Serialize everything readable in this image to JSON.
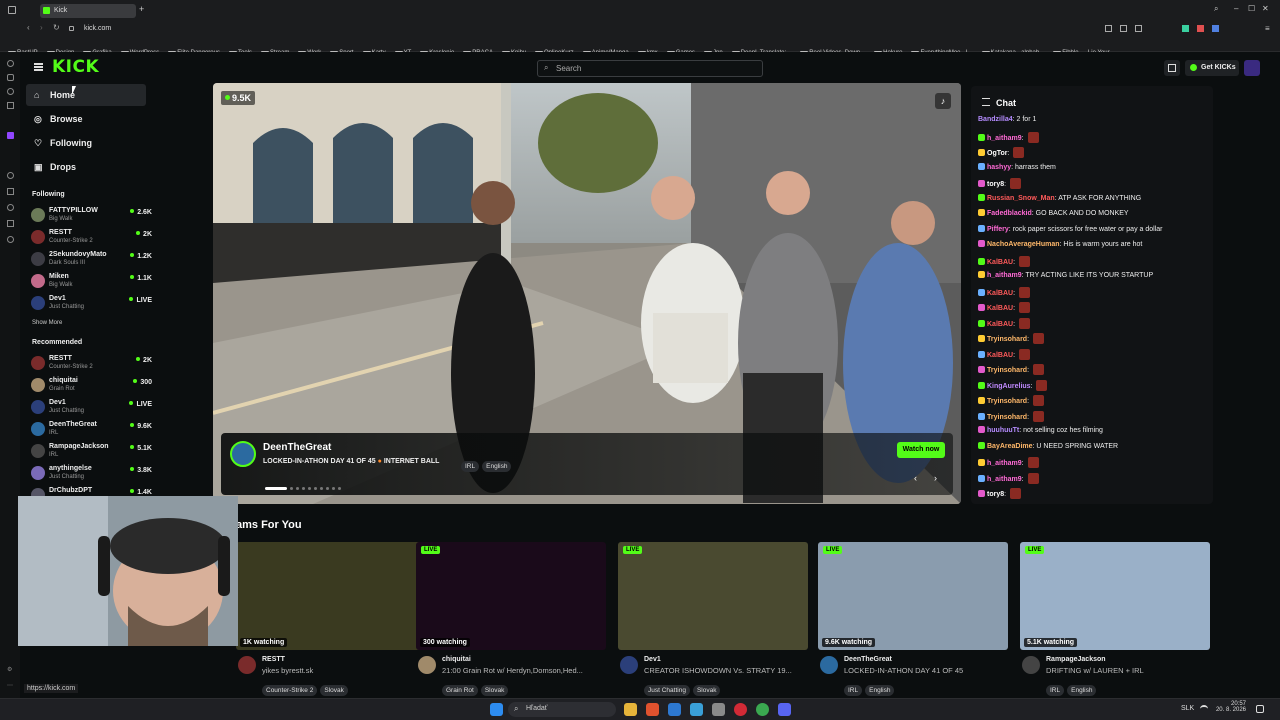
{
  "browser": {
    "tab_title": "Kick",
    "url": "kick.com",
    "status_url": "https://kick.com",
    "bookmarks": [
      "RastUP",
      "Design",
      "Grafika",
      "WordPress",
      "Elite Dangerous",
      "Tools",
      "Stream",
      "Work",
      "Sport",
      "Karty",
      "YT",
      "Kreslenie",
      "PRACA",
      "Knihy",
      "OnlineKurz",
      "Anime/Manga",
      "kmx",
      "Games",
      "Jpn",
      "DeepL Translate:...",
      "Reel Videos, Down...",
      "Hokuro",
      "EverythingMoe - I...",
      "Katakana - alphab...",
      "Fibble — Lie Your..."
    ]
  },
  "header": {
    "logo": "KICK",
    "search_placeholder": "Search",
    "get_kicks": "Get KICKs"
  },
  "nav": {
    "items": [
      {
        "label": "Home",
        "icon": "home-icon"
      },
      {
        "label": "Browse",
        "icon": "compass-icon"
      },
      {
        "label": "Following",
        "icon": "heart-icon"
      },
      {
        "label": "Drops",
        "icon": "gift-icon"
      }
    ]
  },
  "sidebar": {
    "following_title": "Following",
    "following": [
      {
        "name": "FATTYPILLOW",
        "sub": "Big Walk",
        "count": "2.6K",
        "color": "#6b7a58"
      },
      {
        "name": "RESTT",
        "sub": "Counter-Strike 2",
        "count": "2K",
        "color": "#7a2b2b"
      },
      {
        "name": "2SekundovyMato",
        "sub": "Dark Souls III",
        "count": "1.2K",
        "color": "#3c3c44"
      },
      {
        "name": "Miken",
        "sub": "Big Walk",
        "count": "1.1K",
        "color": "#c26a8a"
      },
      {
        "name": "Dev1",
        "sub": "Just Chatting",
        "count": "LIVE",
        "color": "#2b3f7a"
      }
    ],
    "show_more": "Show More",
    "recommended_title": "Recommended",
    "recommended": [
      {
        "name": "RESTT",
        "sub": "Counter-Strike 2",
        "count": "2K",
        "color": "#7a2b2b"
      },
      {
        "name": "chiquitai",
        "sub": "Grain Rot",
        "count": "300",
        "color": "#a08a6a"
      },
      {
        "name": "Dev1",
        "sub": "Just Chatting",
        "count": "LIVE",
        "color": "#2b3f7a"
      },
      {
        "name": "DeenTheGreat",
        "sub": "IRL",
        "count": "9.6K",
        "color": "#2b6aa0"
      },
      {
        "name": "RampageJackson",
        "sub": "IRL",
        "count": "5.1K",
        "color": "#444"
      },
      {
        "name": "anythingelse",
        "sub": "Just Chatting",
        "count": "3.8K",
        "color": "#7a6ab8"
      },
      {
        "name": "DrChubzDPT",
        "sub": "",
        "count": "1.4K",
        "color": "#556"
      }
    ]
  },
  "hero": {
    "viewers": "9.5K",
    "streamer": "DeenTheGreat",
    "title": "LOCKED-IN-ATHON DAY 41 OF 45",
    "title_suffix": "INTERNET BALL",
    "tags": [
      "IRL",
      "English"
    ],
    "watch_now": "Watch now",
    "slide_count": 10,
    "active_slide": 0
  },
  "chat": {
    "title": "Chat",
    "messages": [
      {
        "user": "Bandzilla4",
        "text": "2 for 1",
        "color": "#b58cff",
        "emote": false
      },
      {
        "user": "h_aitham9",
        "text": "",
        "color": "#ff6ad5",
        "emote": true
      },
      {
        "user": "OgTor",
        "text": "",
        "color": "#ffffff",
        "emote": true
      },
      {
        "user": "hashyy",
        "text": "harrass them",
        "color": "#ff6ad5",
        "emote": false
      },
      {
        "user": "tory8",
        "text": "",
        "color": "#ffffff",
        "emote": true
      },
      {
        "user": "Russian_Snow_Man",
        "text": "ATP ASK FOR ANYTHING",
        "color": "#ff5a5a",
        "emote": false
      },
      {
        "user": "Fadedblackid",
        "text": "GO BACK AND DO MONKEY",
        "color": "#ff6ad5",
        "emote": false
      },
      {
        "user": "Piffery",
        "text": "rock paper scissors for free water or pay a dollar",
        "color": "#ff6ad5",
        "emote": false
      },
      {
        "user": "NachoAverageHuman",
        "text": "His is warm yours are hot",
        "color": "#ffb86a",
        "emote": false
      },
      {
        "user": "KalBAU",
        "text": "",
        "color": "#ff5a5a",
        "emote": true
      },
      {
        "user": "h_aitham9",
        "text": "TRY ACTING LIKE ITS YOUR STARTUP",
        "color": "#ff6ad5",
        "emote": false
      },
      {
        "user": "KalBAU",
        "text": "",
        "color": "#ff5a5a",
        "emote": true
      },
      {
        "user": "KalBAU",
        "text": "",
        "color": "#ff5a5a",
        "emote": true
      },
      {
        "user": "KalBAU",
        "text": "",
        "color": "#ff5a5a",
        "emote": true
      },
      {
        "user": "Tryinsohard",
        "text": "",
        "color": "#ffb86a",
        "emote": true
      },
      {
        "user": "KalBAU",
        "text": "",
        "color": "#ff5a5a",
        "emote": true
      },
      {
        "user": "Tryinsohard",
        "text": "",
        "color": "#ffb86a",
        "emote": true
      },
      {
        "user": "KingAurelius",
        "text": "",
        "color": "#c08aff",
        "emote": true
      },
      {
        "user": "Tryinsohard",
        "text": "",
        "color": "#ffb86a",
        "emote": true
      },
      {
        "user": "Tryinsohard",
        "text": "",
        "color": "#ffb86a",
        "emote": true
      },
      {
        "user": "huuhuuTt",
        "text": "not selling coz hes filming",
        "color": "#b58cff",
        "emote": false
      },
      {
        "user": "BayAreaDime",
        "text": "U NEED SPRING WATER",
        "color": "#ffb86a",
        "emote": false
      },
      {
        "user": "h_aitham9",
        "text": "",
        "color": "#ff6ad5",
        "emote": true
      },
      {
        "user": "h_aitham9",
        "text": "",
        "color": "#ff6ad5",
        "emote": true
      },
      {
        "user": "tory8",
        "text": "",
        "color": "#ffffff",
        "emote": true
      }
    ]
  },
  "section": {
    "title": "ams For You",
    "cards": [
      {
        "name": "RESTT",
        "title": "yikes byrestt.sk",
        "watching": "1K watching",
        "tags": [
          "Counter-Strike 2",
          "Slovak"
        ],
        "live": false,
        "thumb": "#3a3a20",
        "avatar": "#7a2b2b"
      },
      {
        "name": "chiquitai",
        "title": "21:00 Grain Rot w/ Herdyn,Domson,Hed...",
        "watching": "300 watching",
        "tags": [
          "Grain Rot",
          "Slovak"
        ],
        "live": true,
        "thumb": "#1a0a1a",
        "avatar": "#a08a6a"
      },
      {
        "name": "Dev1",
        "title": "CREATOR ISHOWDOWN Vs. STRATY 19...",
        "watching": "",
        "tags": [
          "Just Chatting",
          "Slovak"
        ],
        "live": true,
        "thumb": "#4a4a30",
        "avatar": "#2b3f7a"
      },
      {
        "name": "DeenTheGreat",
        "title": "LOCKED-IN-ATHON DAY 41 OF 45",
        "watching": "9.6K watching",
        "tags": [
          "IRL",
          "English"
        ],
        "live": true,
        "thumb": "#8a9cae",
        "avatar": "#2b6aa0"
      },
      {
        "name": "RampageJackson",
        "title": "DRIFTING w/ LAUREN + IRL",
        "watching": "5.1K watching",
        "tags": [
          "IRL",
          "English"
        ],
        "live": true,
        "thumb": "#9ab0c8",
        "avatar": "#444"
      }
    ]
  },
  "taskbar": {
    "search": "Hľadať",
    "lang": "SLK",
    "time": "20:57",
    "date": "20. 8. 2026"
  },
  "colors": {
    "accent": "#53fc18",
    "bg": "#0b0e0f",
    "panel": "#111315"
  }
}
